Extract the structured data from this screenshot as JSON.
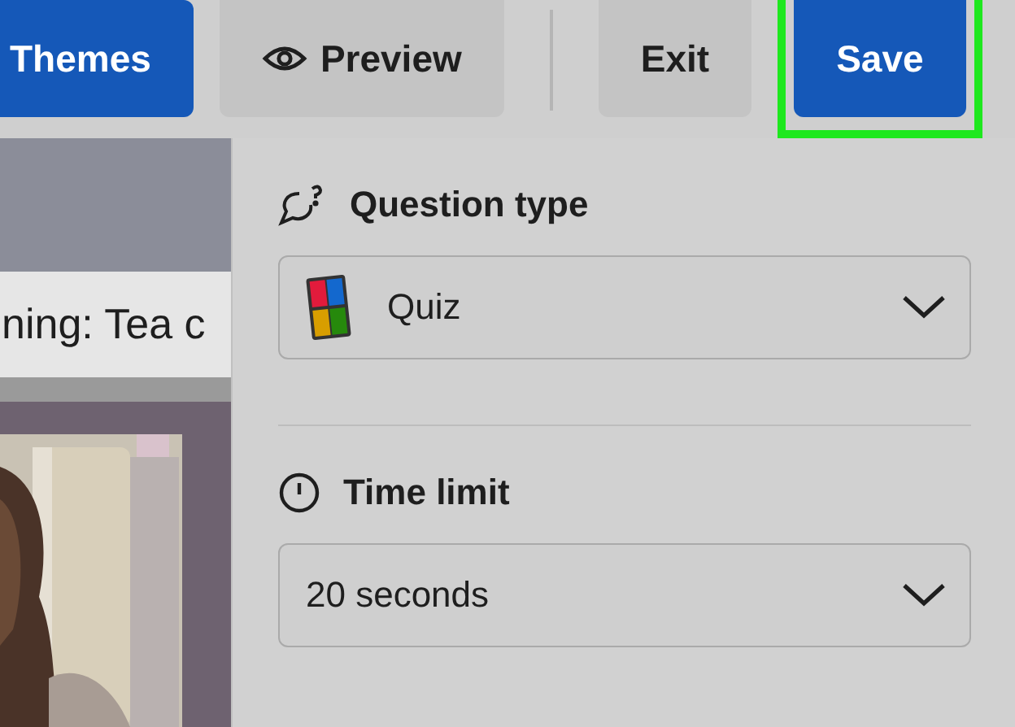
{
  "toolbar": {
    "buttons": [
      {
        "label": "Themes",
        "kind": "primary",
        "highlighted": false
      },
      {
        "label": "Preview",
        "kind": "icon-secondary",
        "highlighted": false
      },
      {
        "label": "Exit",
        "kind": "secondary",
        "highlighted": false
      },
      {
        "label": "Save",
        "kind": "primary",
        "highlighted": true
      }
    ]
  },
  "canvas": {
    "question_title": "ning: Tea c"
  },
  "panel": {
    "sections": [
      {
        "kind": "question-type",
        "heading": "Question type",
        "value": "Quiz"
      },
      {
        "kind": "time-limit",
        "heading": "Time limit",
        "value": "20 seconds"
      }
    ]
  }
}
